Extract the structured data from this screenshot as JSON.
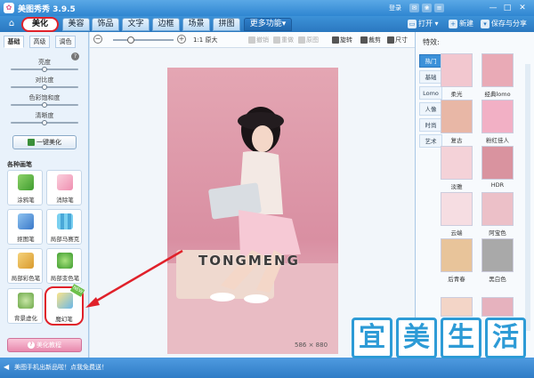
{
  "window": {
    "title": "美图秀秀 3.9.5",
    "login": "登录"
  },
  "toolbar": {
    "tabs": [
      "美化",
      "美容",
      "饰品",
      "文字",
      "边框",
      "场景",
      "拼图",
      "更多功能▾"
    ],
    "open_label": "打开 ▾",
    "new_label": "新建",
    "save_label": "保存与分享"
  },
  "left": {
    "subtabs": [
      "基础",
      "高级",
      "调色"
    ],
    "adjustments": [
      "亮度",
      "对比度",
      "色彩饱和度",
      "清晰度"
    ],
    "adjustment_levels": [
      0.5,
      0.5,
      0.5,
      0.5
    ],
    "one_key_label": "一键美化",
    "brushes_title": "各种画笔",
    "brushes": [
      "涂鸦笔",
      "消除笔",
      "抠图笔",
      "局部马赛克",
      "局部彩色笔",
      "局部变色笔",
      "背景虚化",
      "魔幻笔"
    ],
    "new_badge": "NEW",
    "tutorial_label": "美化教程"
  },
  "canvas": {
    "zoom_minus": "−",
    "zoom_plus": "+",
    "original_size": "1:1 原大",
    "undo": "撤销",
    "redo": "重做",
    "reset": "原图",
    "rotate": "旋转",
    "crop": "裁剪",
    "resize": "尺寸",
    "watermark": "TONGMENG",
    "dimensions": "586 × 880",
    "zoom_level": 0.3
  },
  "right": {
    "title": "特效:",
    "categories": [
      "热门",
      "基础",
      "Lomo",
      "人像",
      "时尚",
      "艺术"
    ],
    "effects": [
      "柔光",
      "经典lomo",
      "复古",
      "粉红佳人",
      "淡雅",
      "HDR",
      "云端",
      "阿宝色",
      "后青春",
      "黑白色"
    ]
  },
  "status": {
    "text": "美图手机出新品啦！点我免费送！"
  },
  "brand": [
    "宜",
    "美",
    "生",
    "活"
  ],
  "colors": {
    "accent": "#2f86d1",
    "highlight": "#e0212a",
    "brand": "#2d9bd6"
  }
}
